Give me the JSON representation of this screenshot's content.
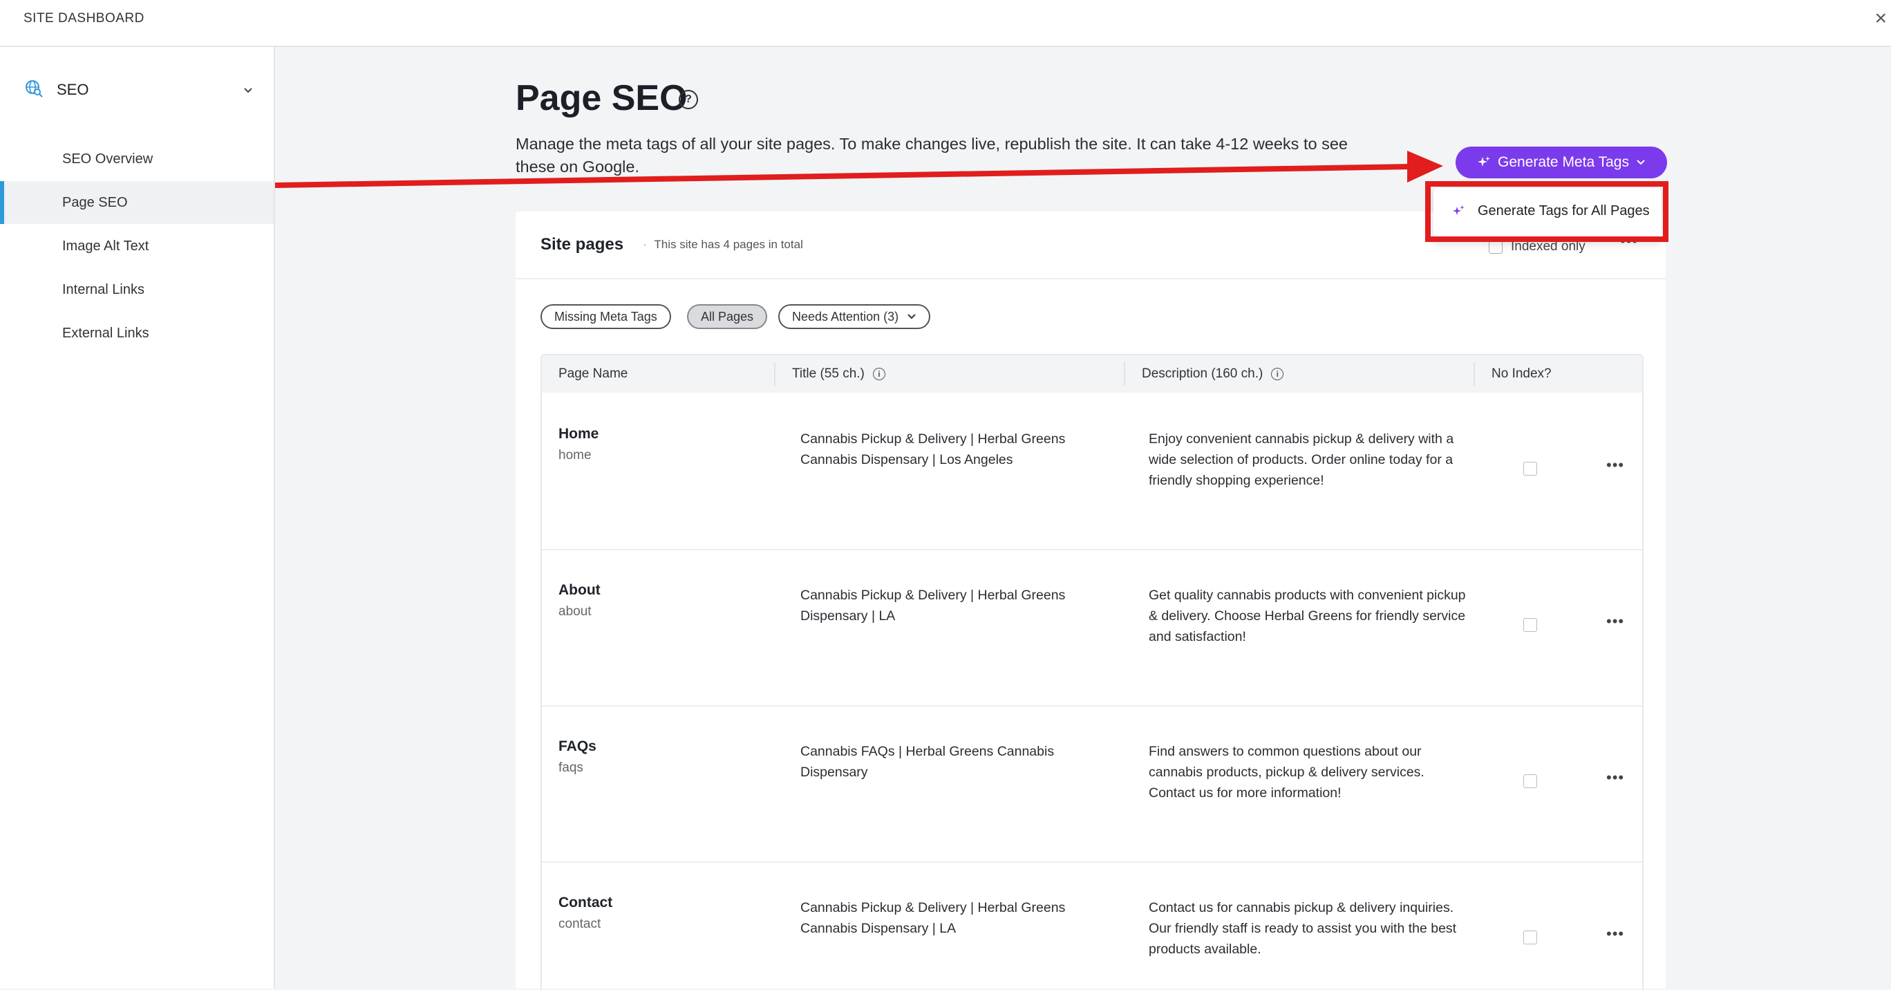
{
  "topbar": {
    "brand": "SITE DASHBOARD",
    "close": "×"
  },
  "sidebar": {
    "section": "SEO",
    "items": [
      {
        "label": "SEO Overview"
      },
      {
        "label": "Page SEO"
      },
      {
        "label": "Image Alt Text"
      },
      {
        "label": "Internal Links"
      },
      {
        "label": "External Links"
      }
    ]
  },
  "main": {
    "title": "Page SEO",
    "help_glyph": "?",
    "description": "Manage the meta tags of all your site pages. To make changes live, republish the site. It can take 4-12 weeks to see these on Google.",
    "generate_button": "Generate Meta Tags",
    "generate_menu_item": "Generate Tags for All Pages"
  },
  "card": {
    "title": "Site pages",
    "subtitle": "This site has 4 pages in total",
    "indexed_only": "Indexed only",
    "filters": [
      "Missing Meta Tags",
      "All Pages",
      "Needs Attention (3)"
    ],
    "columns": [
      "Page Name",
      "Title (55 ch.)",
      "Description (160 ch.)",
      "No Index?"
    ]
  },
  "pages": [
    {
      "name": "Home",
      "slug": "home",
      "title": "Cannabis Pickup & Delivery | Herbal Greens Cannabis Dispensary | Los Angeles",
      "description": "Enjoy convenient cannabis pickup & delivery with a wide selection of products. Order online today for a friendly shopping experience!"
    },
    {
      "name": "About",
      "slug": "about",
      "title": "Cannabis Pickup & Delivery | Herbal Greens Dispensary | LA",
      "description": "Get quality cannabis products with convenient pickup & delivery. Choose Herbal Greens for friendly service and satisfaction!"
    },
    {
      "name": "FAQs",
      "slug": "faqs",
      "title": "Cannabis FAQs | Herbal Greens Cannabis Dispensary",
      "description": "Find answers to common questions about our cannabis products, pickup & delivery services. Contact us for more information!"
    },
    {
      "name": "Contact",
      "slug": "contact",
      "title": "Cannabis Pickup & Delivery | Herbal Greens Cannabis Dispensary | LA",
      "description": "Contact us for cannabis pickup & delivery inquiries. Our friendly staff is ready to assist you with the best products available."
    }
  ],
  "colors": {
    "accent": "#7c3aed",
    "annotation": "#e11d1d",
    "active_marker": "#2f9ad8"
  },
  "icons": {
    "seo": "globe-search-icon",
    "sparkle": "sparkle-icon",
    "info": "info-icon",
    "more": "more-icon"
  }
}
